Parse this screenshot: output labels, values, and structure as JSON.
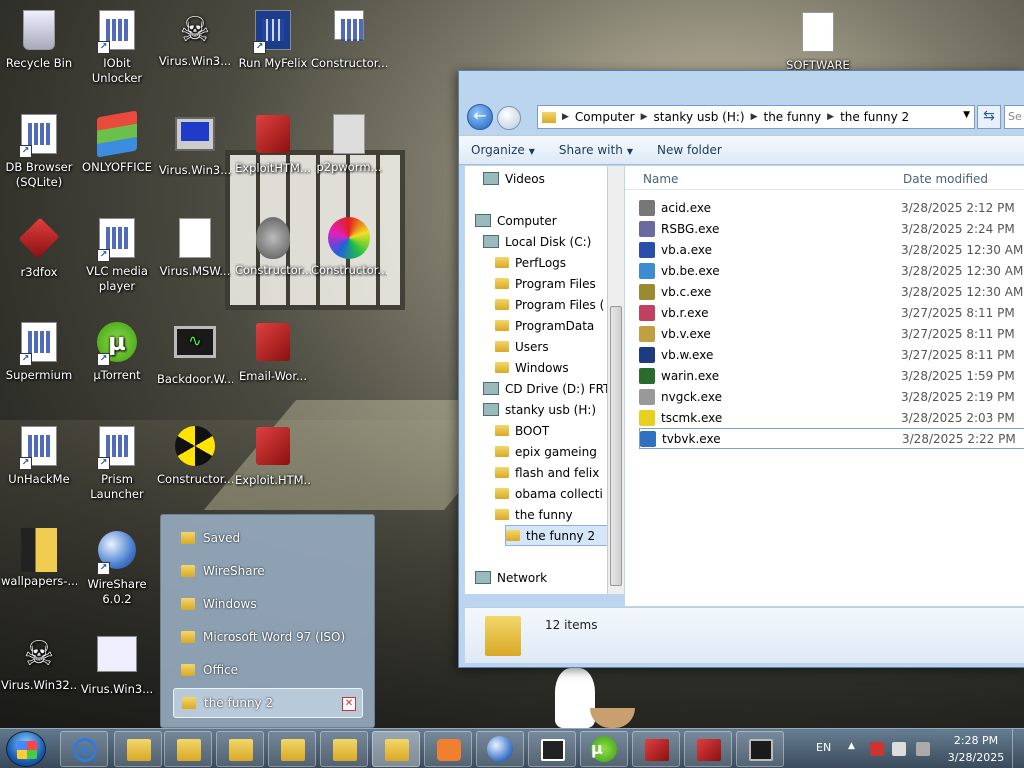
{
  "desktop": {
    "icons": [
      {
        "label": "Recycle Bin",
        "kind": "bin"
      },
      {
        "label": "IObit Unlocker",
        "kind": "app"
      },
      {
        "label": "Virus.Win3...",
        "kind": "skull"
      },
      {
        "label": "Run MyFelix",
        "kind": "app"
      },
      {
        "label": "Constructor...",
        "kind": "app"
      },
      {
        "label": "DB Browser (SQLite)",
        "kind": "app"
      },
      {
        "label": "ONLYOFFICE",
        "kind": "onlyoffice"
      },
      {
        "label": "Virus.Win3...",
        "kind": "pc"
      },
      {
        "label": "ExploitHTM...",
        "kind": "red"
      },
      {
        "label": "p2pworm...",
        "kind": "app"
      },
      {
        "label": "r3dfox",
        "kind": "red"
      },
      {
        "label": "VLC media player",
        "kind": "app"
      },
      {
        "label": "Virus.MSW...",
        "kind": "doc"
      },
      {
        "label": "Constructor...",
        "kind": "alien"
      },
      {
        "label": "Constructor...",
        "kind": "spiral"
      },
      {
        "label": "Supermium",
        "kind": "app"
      },
      {
        "label": "µTorrent",
        "kind": "utorrent"
      },
      {
        "label": "Backdoor.W...",
        "kind": "scope"
      },
      {
        "label": "Email-Wor...",
        "kind": "red"
      },
      {
        "label": "UnHackMe",
        "kind": "app"
      },
      {
        "label": "Prism Launcher",
        "kind": "app"
      },
      {
        "label": "Constructor...",
        "kind": "nuke"
      },
      {
        "label": "Exploit.HTM...",
        "kind": "red"
      },
      {
        "label": "wallpapers-...",
        "kind": "wall"
      },
      {
        "label": "WireShare 6.0.2",
        "kind": "globe"
      },
      {
        "label": "Virus.Win32...",
        "kind": "skull"
      },
      {
        "label": "Virus.Win3...",
        "kind": "ws"
      },
      {
        "label": "SOFTWARE",
        "kind": "doc"
      }
    ]
  },
  "explorer": {
    "breadcrumb": [
      "Computer",
      "stanky usb (H:)",
      "the funny",
      "the funny 2"
    ],
    "search_placeholder": "Se",
    "toolbar": {
      "organize": "Organize",
      "share": "Share with",
      "newfolder": "New folder"
    },
    "nav": [
      {
        "label": "Videos",
        "type": "lib"
      },
      {
        "label": "Computer",
        "type": "drive"
      },
      {
        "label": "Local Disk (C:)",
        "type": "drive"
      },
      {
        "label": "PerfLogs",
        "type": "folder"
      },
      {
        "label": "Program Files",
        "type": "folder"
      },
      {
        "label": "Program Files (",
        "type": "folder"
      },
      {
        "label": "ProgramData",
        "type": "folder"
      },
      {
        "label": "Users",
        "type": "folder"
      },
      {
        "label": "Windows",
        "type": "folder"
      },
      {
        "label": "CD Drive (D:) FRT",
        "type": "drive"
      },
      {
        "label": "stanky usb (H:)",
        "type": "drive"
      },
      {
        "label": "BOOT",
        "type": "folder"
      },
      {
        "label": "epix gameing",
        "type": "folder"
      },
      {
        "label": "flash and felix",
        "type": "folder"
      },
      {
        "label": "obama collecti",
        "type": "folder"
      },
      {
        "label": "the funny",
        "type": "folder"
      },
      {
        "label": "the funny 2",
        "type": "folder"
      },
      {
        "label": "Network",
        "type": "drive"
      }
    ],
    "columns": {
      "name": "Name",
      "date": "Date modified"
    },
    "files": [
      {
        "name": "acid.exe",
        "date": "3/28/2025 2:12 PM",
        "color": "#777"
      },
      {
        "name": "RSBG.exe",
        "date": "3/28/2025 2:24 PM",
        "color": "#6a6aa0"
      },
      {
        "name": "vb.a.exe",
        "date": "3/28/2025 12:30 AM",
        "color": "#2a4fa8"
      },
      {
        "name": "vb.be.exe",
        "date": "3/28/2025 12:30 AM",
        "color": "#3c8cd0"
      },
      {
        "name": "vb.c.exe",
        "date": "3/28/2025 12:30 AM",
        "color": "#9a8a30"
      },
      {
        "name": "vb.r.exe",
        "date": "3/27/2025 8:11 PM",
        "color": "#c04060"
      },
      {
        "name": "vb.v.exe",
        "date": "3/27/2025 8:11 PM",
        "color": "#c0a040"
      },
      {
        "name": "vb.w.exe",
        "date": "3/27/2025 8:11 PM",
        "color": "#1e3a80"
      },
      {
        "name": "warin.exe",
        "date": "3/28/2025 1:59 PM",
        "color": "#2a6a2a"
      },
      {
        "name": "nvgck.exe",
        "date": "3/28/2025 2:19 PM",
        "color": "#999"
      },
      {
        "name": "tscmk.exe",
        "date": "3/28/2025 2:03 PM",
        "color": "#e8d020"
      },
      {
        "name": "tvbvk.exe",
        "date": "3/28/2025 2:22 PM",
        "color": "#3070c0"
      }
    ],
    "status": "12 items"
  },
  "jumplist": {
    "items": [
      "Saved",
      "WireShare",
      "Windows",
      "Microsoft Word 97 (ISO)",
      "Office",
      "the funny 2"
    ]
  },
  "taskbar": {
    "lang": "EN",
    "time": "2:28 PM",
    "date": "3/28/2025"
  }
}
